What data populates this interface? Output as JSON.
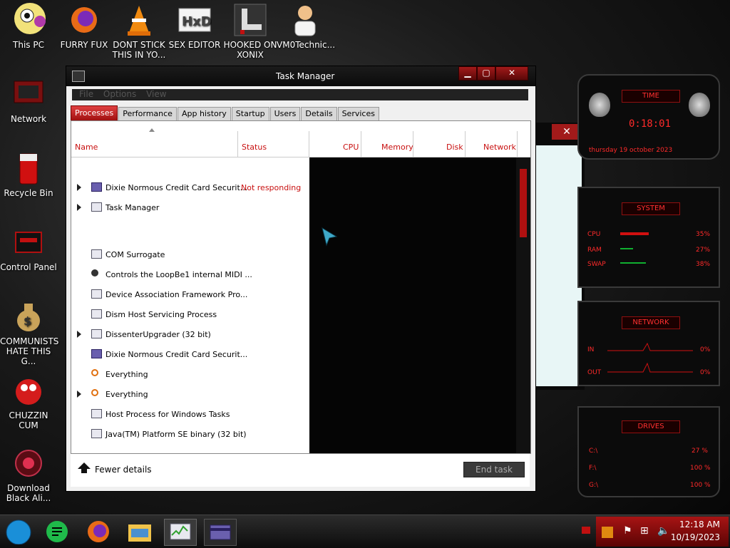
{
  "desktop_icons": [
    {
      "label": "This PC"
    },
    {
      "label": "FURRY FUX"
    },
    {
      "label": "DONT STICK THIS IN YO..."
    },
    {
      "label": "SEX EDITOR"
    },
    {
      "label": "HOOKED ON XONIX"
    },
    {
      "label": "VM0Technic..."
    },
    {
      "label": "Network"
    },
    {
      "label": "Recycle Bin"
    },
    {
      "label": "Control Panel"
    },
    {
      "label": "COMMUNISTS HATE THIS G..."
    },
    {
      "label": "CHUZZIN CUM"
    },
    {
      "label": "Download Black Ali..."
    }
  ],
  "window": {
    "title": "Task Manager",
    "menu": [
      "File",
      "Options",
      "View"
    ],
    "tabs": [
      "Processes",
      "Performance",
      "App history",
      "Startup",
      "Users",
      "Details",
      "Services"
    ],
    "columns": {
      "name": "Name",
      "status": "Status",
      "cpu": "CPU",
      "memory": "Memory",
      "disk": "Disk",
      "network": "Network"
    },
    "processes": [
      {
        "name": "Dixie Normous Credit Card Securit...",
        "status": "Not responding"
      },
      {
        "name": "Task Manager",
        "status": ""
      },
      {
        "name": "COM Surrogate",
        "status": ""
      },
      {
        "name": "Controls the LoopBe1 internal MIDI ...",
        "status": ""
      },
      {
        "name": "Device Association Framework Pro...",
        "status": ""
      },
      {
        "name": "Dism Host Servicing Process",
        "status": ""
      },
      {
        "name": "DissenterUpgrader (32 bit)",
        "status": ""
      },
      {
        "name": "Dixie Normous Credit Card Securit...",
        "status": ""
      },
      {
        "name": "Everything",
        "status": ""
      },
      {
        "name": "Everything",
        "status": ""
      },
      {
        "name": "Host Process for Windows Tasks",
        "status": ""
      },
      {
        "name": "Java(TM) Platform SE binary (32 bit)",
        "status": ""
      }
    ],
    "fewer_details": "Fewer details",
    "end_task": "End task"
  },
  "widget": {
    "time_title": "TIME",
    "time": "0:18:01",
    "date": "thursday 19 october 2023",
    "system_title": "SYSTEM",
    "cpu_label": "CPU",
    "cpu_value": "35%",
    "ram_label": "RAM",
    "ram_value": "27%",
    "swap_label": "SWAP",
    "swap_value": "38%",
    "network_title": "NETWORK",
    "in_label": "IN",
    "in_value": "0%",
    "out_label": "OUT",
    "out_value": "0%",
    "drives_title": "DRIVES",
    "drives": [
      {
        "label": "C:\\",
        "value": "27 %"
      },
      {
        "label": "F:\\",
        "value": "100 %"
      },
      {
        "label": "G:\\",
        "value": "100 %"
      }
    ]
  },
  "taskbar": {
    "time": "12:18 AM",
    "date": "10/19/2023"
  }
}
